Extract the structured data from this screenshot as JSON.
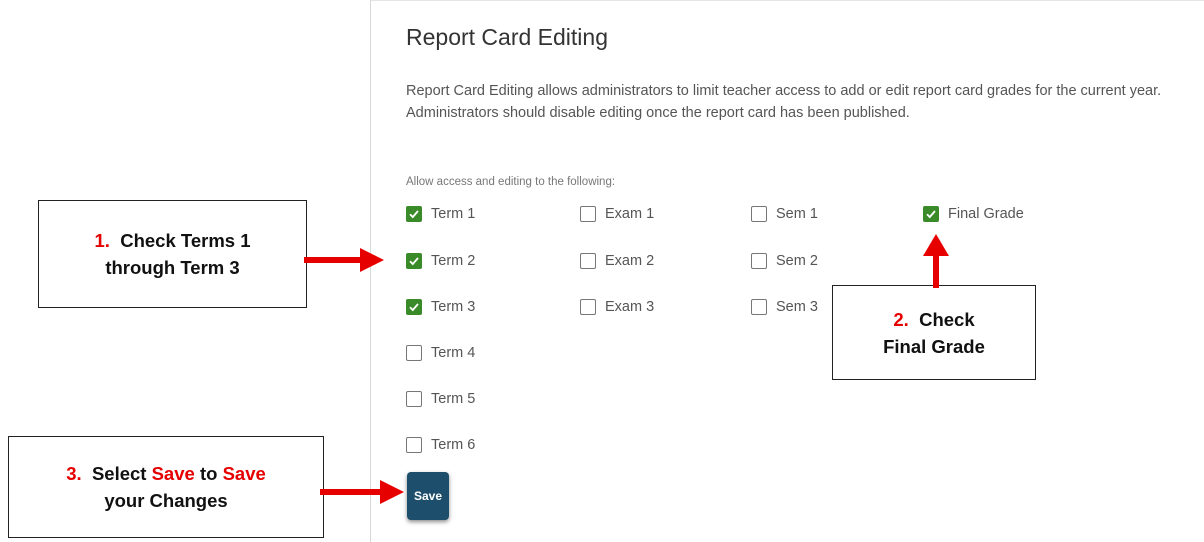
{
  "page": {
    "title": "Report Card Editing",
    "description": "Report Card Editing allows administrators to limit teacher access to add or edit report card grades for the current year. Administrators should disable editing once the report card has been published.",
    "allow_label": "Allow access and editing to the following:",
    "save_label": "Save"
  },
  "checkboxes": {
    "term1": {
      "label": "Term 1",
      "checked": true
    },
    "term2": {
      "label": "Term 2",
      "checked": true
    },
    "term3": {
      "label": "Term 3",
      "checked": true
    },
    "term4": {
      "label": "Term 4",
      "checked": false
    },
    "term5": {
      "label": "Term 5",
      "checked": false
    },
    "term6": {
      "label": "Term 6",
      "checked": false
    },
    "exam1": {
      "label": "Exam 1",
      "checked": false
    },
    "exam2": {
      "label": "Exam 2",
      "checked": false
    },
    "exam3": {
      "label": "Exam 3",
      "checked": false
    },
    "sem1": {
      "label": "Sem 1",
      "checked": false
    },
    "sem2": {
      "label": "Sem 2",
      "checked": false
    },
    "sem3": {
      "label": "Sem 3",
      "checked": false
    },
    "final": {
      "label": "Final Grade",
      "checked": true
    }
  },
  "callouts": {
    "step1": {
      "number": "1.",
      "line1": "Check Terms 1",
      "line2": "through Term 3"
    },
    "step2": {
      "number": "2.",
      "line1": "Check",
      "line2": "Final Grade"
    },
    "step3": {
      "number": "3.",
      "pre": "Select ",
      "save_word_1": "Save",
      "mid": " to ",
      "save_word_2": "Save",
      "line2": "your Changes"
    }
  },
  "colors": {
    "checkbox_checked": "#3a8a2a",
    "save_button": "#1d4e6b",
    "callout_red": "#e60000",
    "arrow": "#e60000"
  }
}
